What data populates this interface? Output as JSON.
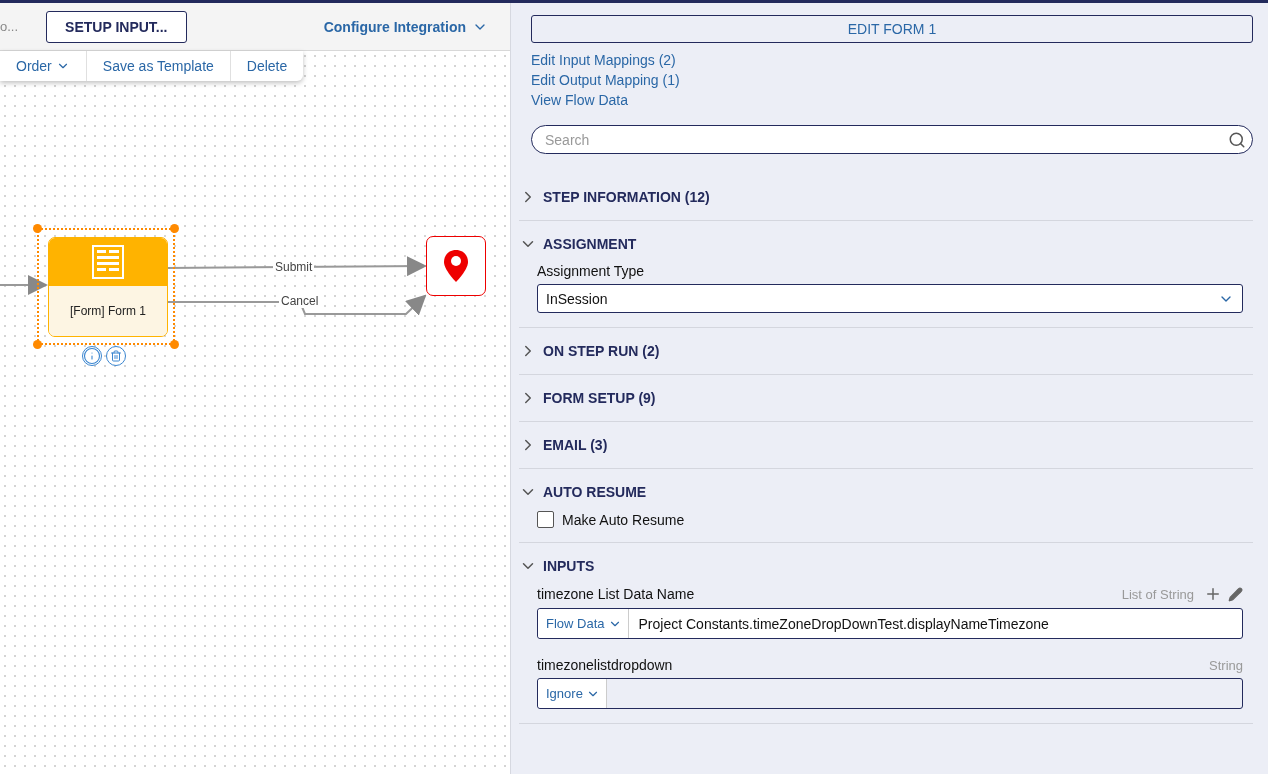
{
  "header": {
    "cut_text": "o...",
    "setup_button": "SETUP INPUT...",
    "configure_menu": "Configure Integration"
  },
  "toolbar": {
    "items": [
      {
        "label": "Order",
        "kind": "menu"
      },
      {
        "label": "Save as Template",
        "kind": "button"
      },
      {
        "label": "Delete",
        "kind": "button"
      }
    ]
  },
  "canvas": {
    "node": {
      "label": "[Form] Form 1",
      "selected": true
    },
    "connectors": [
      {
        "label": "Submit"
      },
      {
        "label": "Cancel"
      }
    ]
  },
  "panel": {
    "edit_button": "EDIT FORM 1",
    "links": [
      "Edit Input Mappings (2)",
      "Edit Output Mapping (1)",
      "View Flow Data"
    ],
    "search": {
      "placeholder": "Search"
    },
    "sections": [
      {
        "title": "STEP INFORMATION (12)",
        "expanded": false
      },
      {
        "title": "ASSIGNMENT",
        "expanded": true,
        "fields": [
          {
            "kind": "select",
            "label": "Assignment Type",
            "value": "InSession"
          }
        ]
      },
      {
        "title": "ON STEP RUN (2)",
        "expanded": false
      },
      {
        "title": "FORM SETUP (9)",
        "expanded": false
      },
      {
        "title": "EMAIL (3)",
        "expanded": false
      },
      {
        "title": "AUTO RESUME",
        "expanded": true,
        "fields": [
          {
            "kind": "checkbox",
            "label": "Make Auto Resume",
            "checked": false
          }
        ]
      },
      {
        "title": "INPUTS",
        "expanded": true,
        "fields": [
          {
            "kind": "mapping",
            "label": "timezone List Data Name",
            "type": "List of String",
            "editable": true,
            "source": "Flow Data",
            "value": "Project Constants.timeZoneDropDownTest.displayNameTimezone"
          },
          {
            "kind": "mapping",
            "label": "timezonelistdropdown",
            "type": "String",
            "editable": false,
            "source": "Ignore"
          }
        ]
      }
    ]
  }
}
